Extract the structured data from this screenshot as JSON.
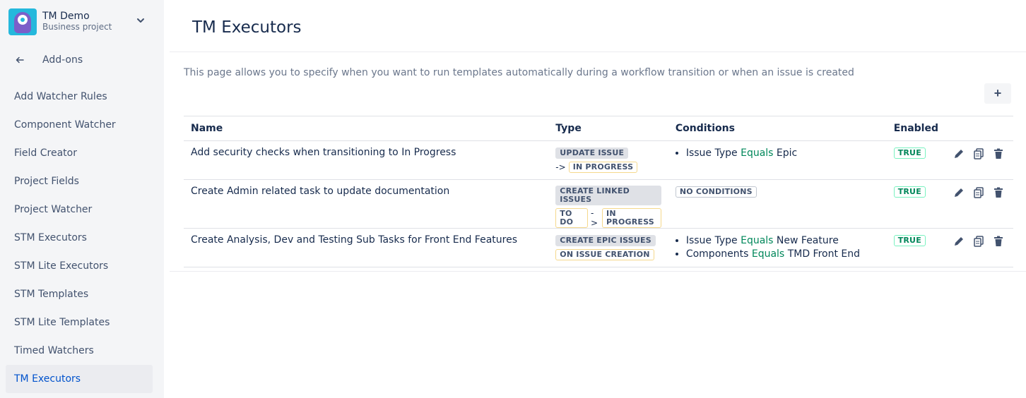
{
  "project": {
    "name": "TM Demo",
    "type": "Business project",
    "avatar_icon": "monster-avatar-icon",
    "accent": "#25b8dc"
  },
  "back": {
    "label": "Add-ons",
    "icon": "arrow-left-icon"
  },
  "sidebar": {
    "items": [
      {
        "label": "Add Watcher Rules"
      },
      {
        "label": "Component Watcher"
      },
      {
        "label": "Field Creator"
      },
      {
        "label": "Project Fields"
      },
      {
        "label": "Project Watcher"
      },
      {
        "label": "STM Executors"
      },
      {
        "label": "STM Lite Executors"
      },
      {
        "label": "STM Templates"
      },
      {
        "label": "STM Lite Templates"
      },
      {
        "label": "Timed Watchers"
      },
      {
        "label": "TM Executors",
        "active": true
      }
    ]
  },
  "page": {
    "title": "TM Executors",
    "description": "This page allows you to specify when you want to run templates automatically during a workflow transition or when an issue is created",
    "add_label": "+"
  },
  "table": {
    "headers": {
      "name": "Name",
      "type": "Type",
      "conditions": "Conditions",
      "enabled": "Enabled"
    },
    "rows": [
      {
        "name": "Add security checks when transitioning to In Progress",
        "type": "UPDATE ISSUE",
        "arrow": "->",
        "from": "",
        "to": "IN PROGRESS",
        "conditions": [
          {
            "field": "Issue Type",
            "op": "Equals",
            "value": "Epic"
          }
        ],
        "enabled": "TRUE"
      },
      {
        "name": "Create Admin related task to update documentation",
        "type": "CREATE LINKED ISSUES",
        "arrow": "->",
        "from": "TO DO",
        "to": "IN PROGRESS",
        "no_conditions": "NO CONDITIONS",
        "enabled": "TRUE"
      },
      {
        "name": "Create Analysis, Dev and Testing Sub Tasks for Front End Features",
        "type": "CREATE EPIC ISSUES",
        "trigger": "ON ISSUE CREATION",
        "conditions": [
          {
            "field": "Issue Type",
            "op": "Equals",
            "value": "New Feature"
          },
          {
            "field": "Components",
            "op": "Equals",
            "value": "TMD Front End"
          }
        ],
        "enabled": "TRUE"
      }
    ]
  },
  "colors": {
    "sidebar_bg": "#f4f5f7",
    "active_link": "#0052cc",
    "operator": "#00875a",
    "text": "#172b4d"
  },
  "action_icons": [
    "pencil-icon",
    "copy-icon",
    "trash-icon"
  ]
}
